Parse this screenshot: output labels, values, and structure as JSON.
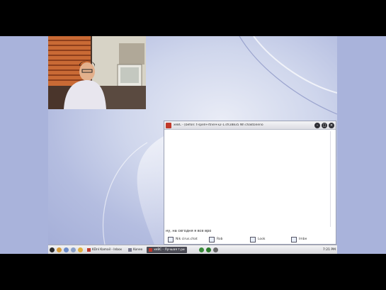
{
  "window": {
    "title": "xeBC - [befon: t-spell+rtnel+x2-1.sfr28835 Nh chaktonerio"
  },
  "chat": {
    "input_text": "ну, на сегодня я все вро"
  },
  "userlist": {
    "items": [
      "Nik cirus.chat",
      "Rob",
      "Look",
      "Imbe"
    ]
  },
  "taskbar": {
    "tasks": [
      "KDnl Kamail - Inbox",
      "Koneo",
      "xeBC - Лучшая т.ри"
    ],
    "clock": "7:21 PM"
  },
  "colors": {
    "accent": "#c0392b",
    "desktop": "#a9b3db"
  }
}
